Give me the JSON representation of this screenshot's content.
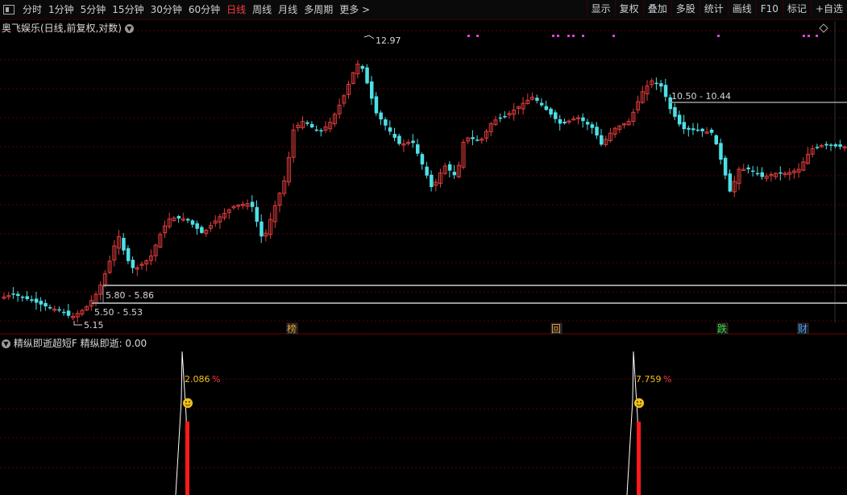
{
  "toolbar": {
    "periods": [
      "分时",
      "1分钟",
      "5分钟",
      "15分钟",
      "30分钟",
      "60分钟",
      "日线",
      "周线",
      "月线",
      "多周期",
      "更多"
    ],
    "active_index": 6,
    "right": [
      "显示",
      "复权",
      "叠加",
      "多股",
      "统计",
      "画线",
      "F10",
      "标记",
      "+自选"
    ]
  },
  "chart": {
    "title": "奥飞娱乐(日线,前复权,对数)",
    "high_label": "12.97",
    "low_label": "5.15",
    "range_labels": [
      "5.80 - 5.86",
      "5.50 - 5.53",
      "10.50 - 10.44"
    ],
    "events": [
      {
        "text": "榜",
        "color": "#e8a33a"
      },
      {
        "text": "回",
        "color": "#e8a33a"
      },
      {
        "text": "跌",
        "color": "#3adf3a"
      },
      {
        "text": "财",
        "color": "#4aa3ff"
      }
    ],
    "colors": {
      "up": "#e23c3c",
      "down": "#4de0e6",
      "grid": "#5a0000",
      "marker": "#e040e0"
    }
  },
  "indicator": {
    "title": "精纵即逝超短F",
    "value_label": "精纵即逝: 0.00",
    "signals": [
      {
        "value": "2.086",
        "unit": "%"
      },
      {
        "value": "7.759",
        "unit": "%"
      }
    ],
    "smile_icon": "smiley-face-icon"
  }
}
